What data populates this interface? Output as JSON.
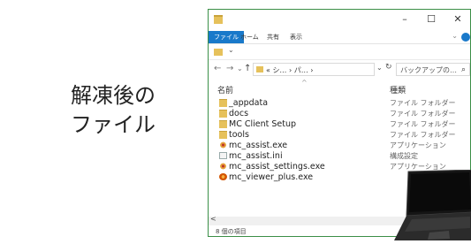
{
  "caption": {
    "line1": "解凍後の",
    "line2": "ファイル"
  },
  "window": {
    "controls": {
      "minimize": "–",
      "maximize": "☐",
      "close": "✕"
    },
    "ribbon_tabs": [
      "ファイル",
      "ホーム",
      "共有",
      "表示"
    ],
    "ribbon_expand": "⌄",
    "address": {
      "back": "←",
      "forward": "→",
      "recent": "⌄",
      "up": "↑",
      "path": "« シ… › パ… ›",
      "dropdown": "⌄",
      "refresh": "↻"
    },
    "search": {
      "placeholder": "バックアップの…",
      "icon": "⌕"
    },
    "columns": {
      "name": "名前",
      "type": "種類",
      "sort": "^"
    },
    "files": [
      {
        "name": "_appdata",
        "type": "ファイル フォルダー",
        "icon": "folder-icon"
      },
      {
        "name": "docs",
        "type": "ファイル フォルダー",
        "icon": "folder-icon"
      },
      {
        "name": "MC Client Setup",
        "type": "ファイル フォルダー",
        "icon": "folder-icon"
      },
      {
        "name": "tools",
        "type": "ファイル フォルダー",
        "icon": "folder-icon"
      },
      {
        "name": "mc_assist.exe",
        "type": "アプリケーション",
        "icon": "gear-exe-icon"
      },
      {
        "name": "mc_assist.ini",
        "type": "構成設定",
        "icon": "ini-file-icon"
      },
      {
        "name": "mc_assist_settings.exe",
        "type": "アプリケーション",
        "icon": "gear-exe-icon"
      },
      {
        "name": "mc_viewer_plus.exe",
        "type": "",
        "icon": "app-exe-icon"
      }
    ],
    "scroll_left": "<",
    "status": "8 個の項目"
  }
}
